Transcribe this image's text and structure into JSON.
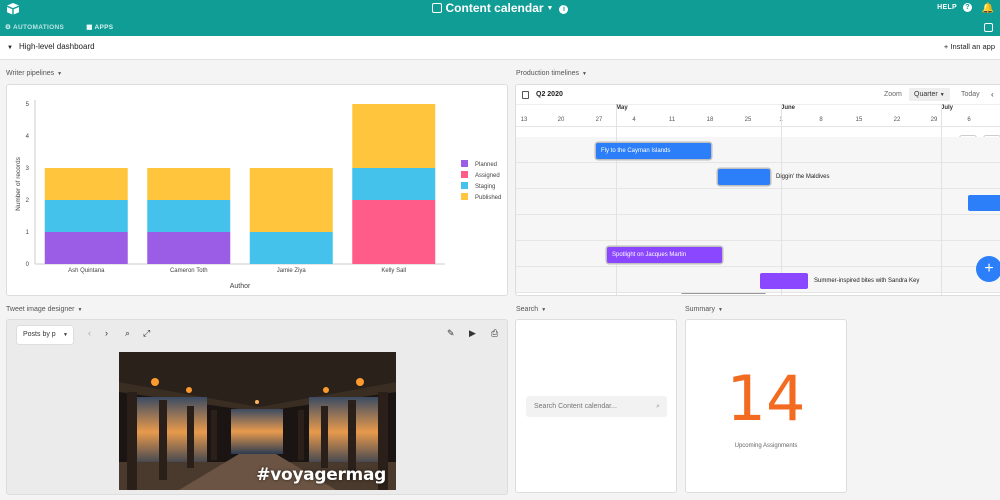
{
  "app": {
    "title": "Content calendar",
    "help_label": "HELP",
    "tabs": [
      {
        "label": "AUTOMATIONS"
      },
      {
        "label": "APPS"
      }
    ]
  },
  "dashboard": {
    "name": "High-level dashboard",
    "install_label": "+ Install an app"
  },
  "sections": {
    "writer_pipelines": "Writer pipelines",
    "production_timelines": "Production timelines",
    "tweet_designer": "Tweet image designer",
    "search": "Search",
    "summary": "Summary"
  },
  "chart_data": {
    "type": "bar",
    "stacked": true,
    "categories": [
      "Ash Quintana",
      "Cameron Toth",
      "Jamie Ziya",
      "Kelly Sall"
    ],
    "series": [
      {
        "name": "Planned",
        "color": "#9b5de5",
        "values": [
          1,
          1,
          0,
          0
        ]
      },
      {
        "name": "Assigned",
        "color": "#ff5c8a",
        "values": [
          0,
          0,
          0,
          2
        ]
      },
      {
        "name": "Staging",
        "color": "#45c2ec",
        "values": [
          1,
          1,
          1,
          1
        ]
      },
      {
        "name": "Published",
        "color": "#ffc53d",
        "values": [
          1,
          1,
          2,
          2
        ]
      }
    ],
    "xlabel": "Author",
    "ylabel": "Number of records",
    "ylim": [
      0,
      5
    ],
    "yticks": [
      0,
      1,
      2,
      3,
      4,
      5
    ],
    "legend_position": "right",
    "grid": false
  },
  "timeline": {
    "quarter_label": "Q2 2020",
    "zoom_label": "Zoom",
    "zoom_value": "Quarter",
    "today_label": "Today",
    "months": [
      "May",
      "June",
      "July"
    ],
    "days": [
      "13",
      "20",
      "27",
      "4",
      "11",
      "18",
      "25",
      "1",
      "8",
      "15",
      "22",
      "29",
      "6"
    ],
    "items": [
      {
        "label": "Fly to the Cayman Islands",
        "color": "blue",
        "label_inside": true
      },
      {
        "label": "Diggin' the Maldives",
        "color": "blue",
        "label_inside": false
      },
      {
        "label": "",
        "color": "blue",
        "label_inside": false
      },
      {
        "label": "Spotlight on Jacques Martin",
        "color": "purple",
        "label_inside": true
      },
      {
        "label": "Summer-inspired bites with Sandra Key",
        "color": "purple",
        "label_inside": false
      }
    ]
  },
  "tweet": {
    "select_value": "Posts by p",
    "hashtag": "#voyagermag"
  },
  "search": {
    "placeholder": "Search Content calendar..."
  },
  "summary": {
    "value": "14",
    "label": "Upcoming Assignments"
  }
}
